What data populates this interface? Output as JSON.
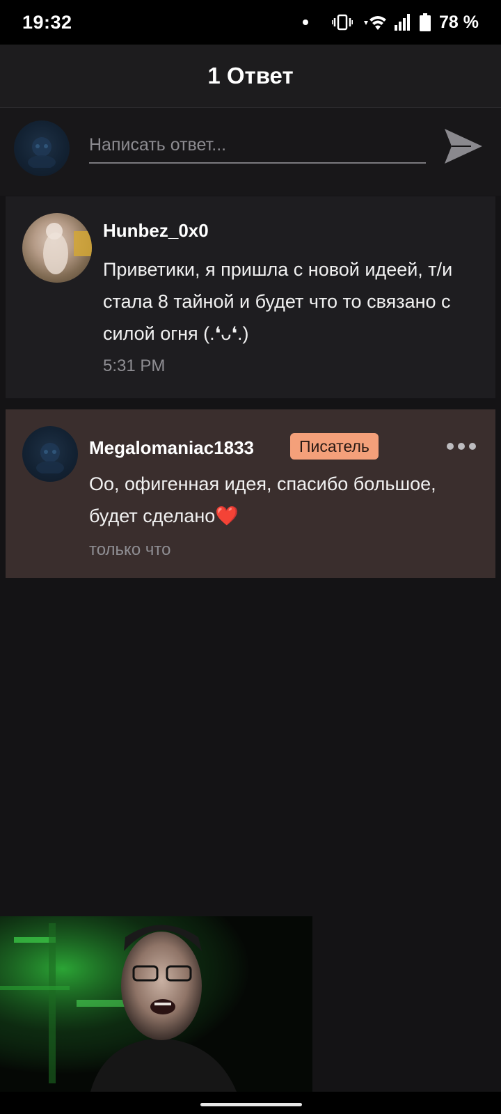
{
  "status_bar": {
    "time": "19:32",
    "battery": "78 %",
    "icons": [
      "notification-dot-icon",
      "vibrate-icon",
      "wifi-icon",
      "signal-icon",
      "battery-icon"
    ]
  },
  "header": {
    "title": "1 Ответ"
  },
  "composer": {
    "placeholder": "Написать ответ...",
    "send_icon": "send-icon"
  },
  "original_comment": {
    "username": "Hunbez_0x0",
    "text": "Приветики, я пришла с новой идеей, т/и стала 8 тайной и будет что то связано с силой огня (.❛ᴗ❛.)",
    "time": "5:31 PM"
  },
  "reply_comment": {
    "username": "Megalomaniac1833",
    "badge": "Писатель",
    "text": "Оо, офигенная идея, спасибо большое, будет сделано❤️",
    "time": "только что",
    "more_icon": "more-horizontal-icon"
  },
  "colors": {
    "background": "#141315",
    "header": "#1d1c1e",
    "reply_highlight": "#3a2e2d",
    "badge": "#f4a07a"
  }
}
